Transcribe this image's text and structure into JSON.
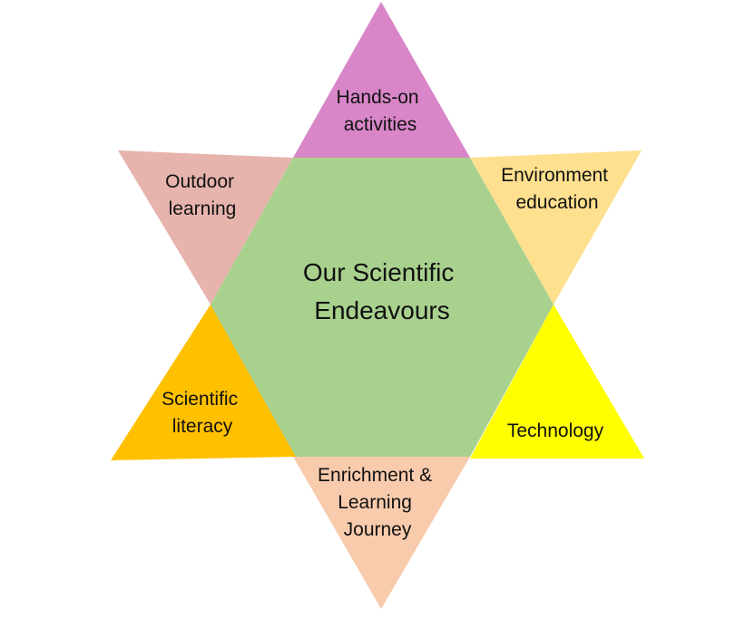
{
  "diagram": {
    "center": {
      "line1": "Our Scientific",
      "line2": "Endeavours",
      "color": "#a9d18e"
    },
    "points": {
      "top": {
        "line1": "Hands-on",
        "line2": "activities",
        "color": "#d986c8"
      },
      "upper_left": {
        "line1": "Outdoor",
        "line2": "learning",
        "color": "#e6b4ad"
      },
      "upper_right": {
        "line1": "Environment",
        "line2": "education",
        "color": "#ffe08f"
      },
      "lower_left": {
        "line1": "Scientific",
        "line2": "literacy",
        "color": "#ffc000"
      },
      "lower_right": {
        "line1": "Technology",
        "color": "#ffff00"
      },
      "bottom": {
        "line1": "Enrichment &",
        "line2": "Learning",
        "line3": "Journey",
        "color": "#f8cbad"
      }
    }
  }
}
